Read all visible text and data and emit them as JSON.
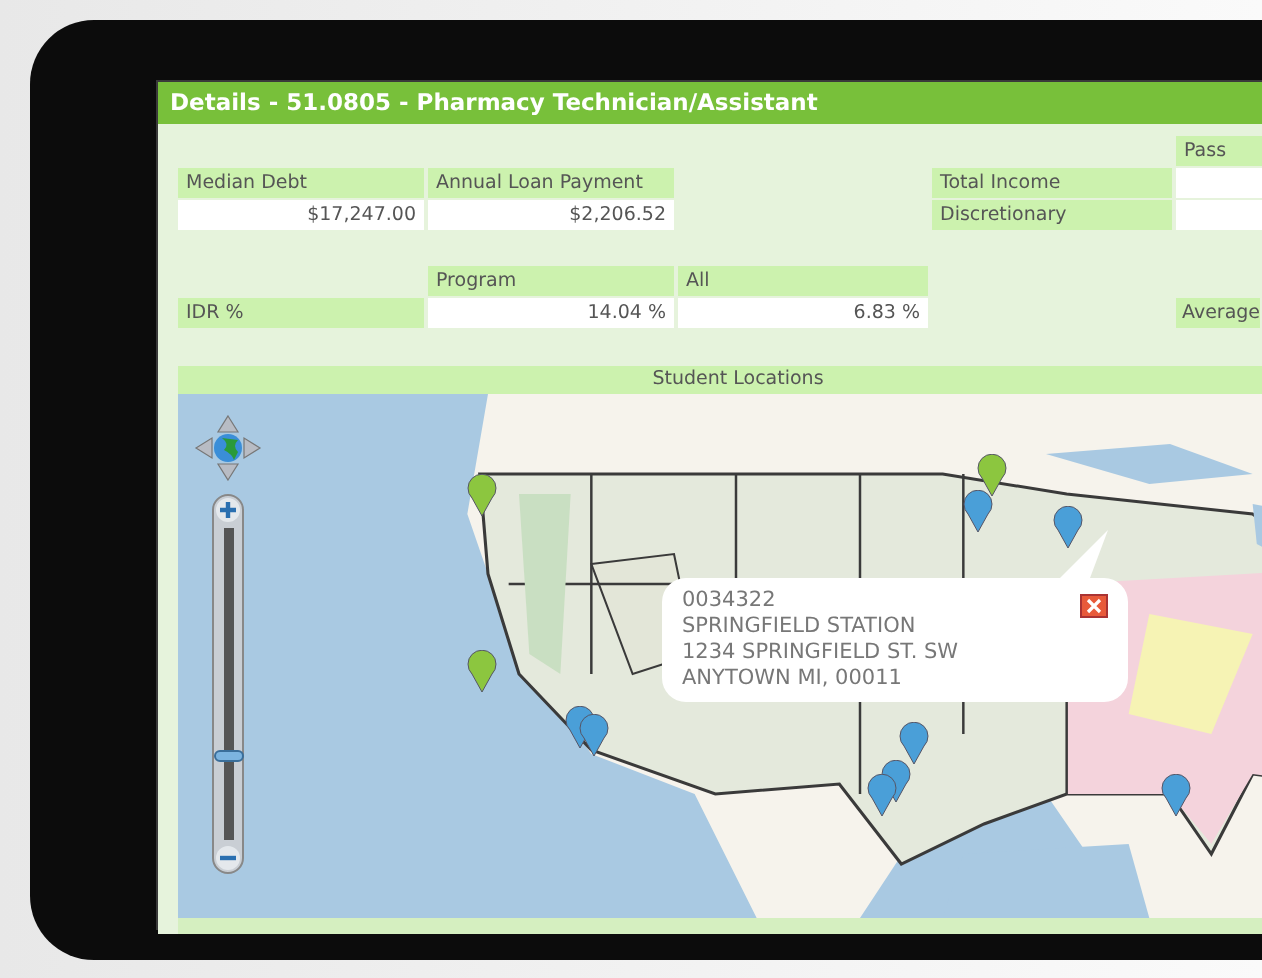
{
  "window": {
    "title": "Details - 51.0805 - Pharmacy Technician/Assistant"
  },
  "debt_table": {
    "columns": [
      "Median Debt",
      "Annual Loan Payment"
    ],
    "values": [
      "$17,247.00",
      "$2,206.52"
    ]
  },
  "income_table": {
    "column_1": "Pass",
    "rows": [
      "Total Income",
      "Discretionary"
    ]
  },
  "idr_table": {
    "columns": [
      "Program",
      "All"
    ],
    "row_label": "IDR %",
    "values": [
      "14.04 %",
      "6.83 %"
    ],
    "column_4": "Average"
  },
  "map": {
    "title": "Student Locations",
    "zoom": {
      "level": 0.25
    },
    "markers": [
      {
        "color": "#8cc63f"
      },
      {
        "color": "#8cc63f"
      },
      {
        "color": "#8cc63f"
      },
      {
        "color": "#4a9fd8"
      },
      {
        "color": "#4a9fd8"
      },
      {
        "color": "#4a9fd8"
      },
      {
        "color": "#4a9fd8"
      },
      {
        "color": "#4a9fd8"
      },
      {
        "color": "#4a9fd8"
      },
      {
        "color": "#4a9fd8"
      },
      {
        "color": "#4a9fd8"
      }
    ],
    "popup": {
      "lines": [
        "0034322",
        "SPRINGFIELD STATION",
        "1234 SPRINGFIELD ST. SW",
        "ANYTOWN MI, 00011"
      ]
    }
  }
}
